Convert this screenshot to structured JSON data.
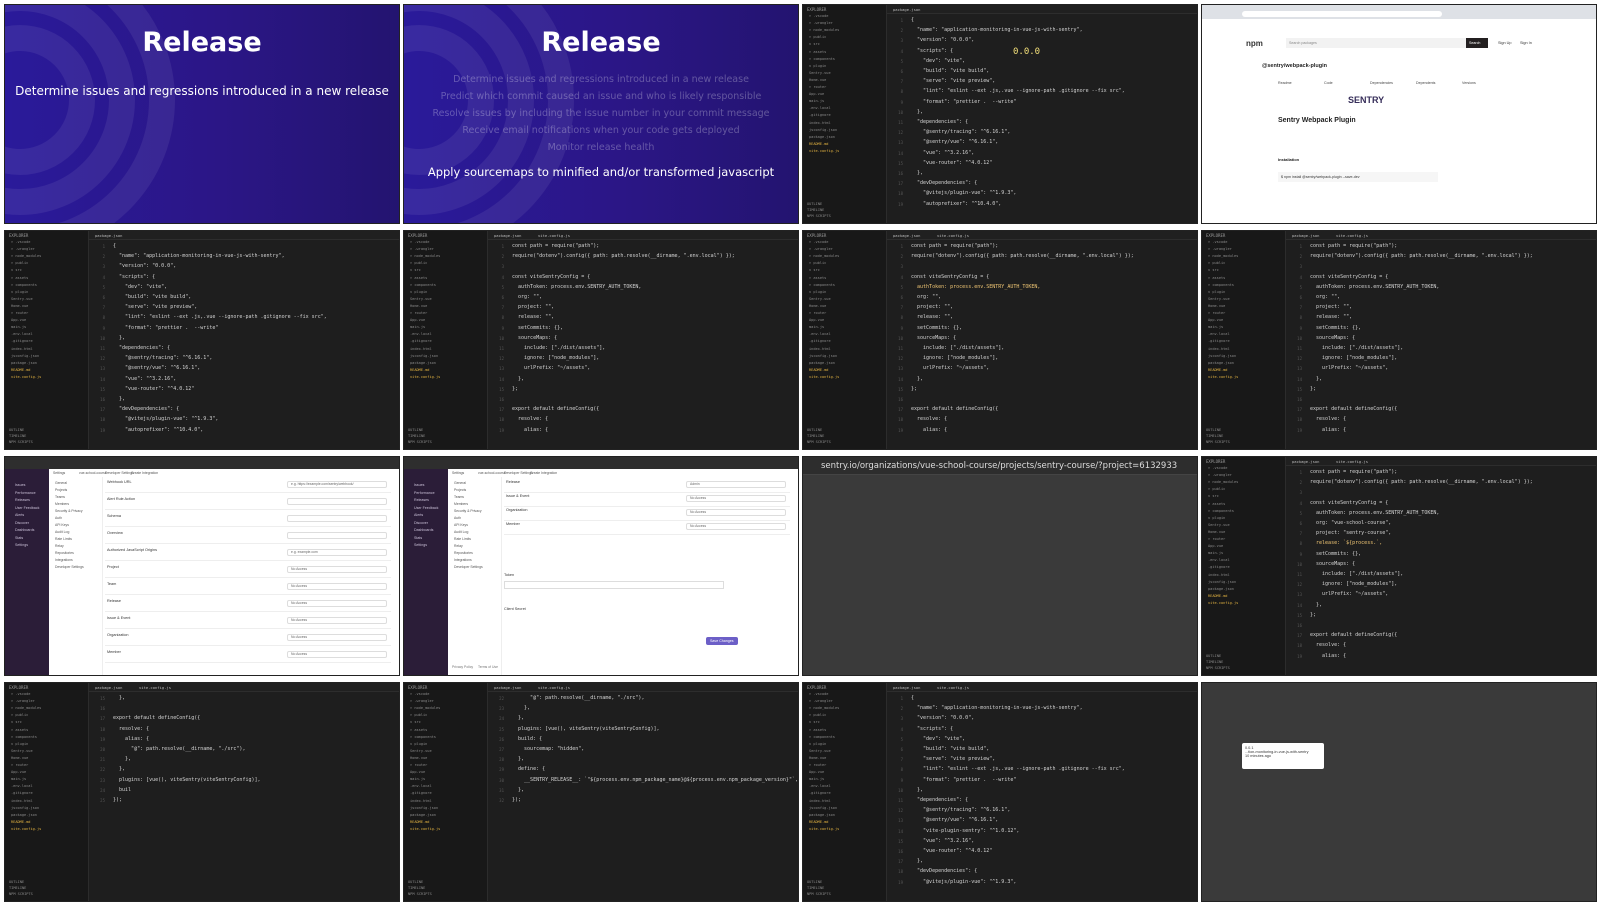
{
  "slides": {
    "release_title": "Release",
    "release_subtitle": "Determine issues and regressions introduced in a new release",
    "list_items": [
      "Determine issues and regressions introduced in a new release",
      "Predict which commit caused an issue and who is likely responsible",
      "Resolve issues by including the issue number in your commit message",
      "Receive email notifications when your code gets deployed",
      "Monitor release health"
    ],
    "highlight": "Apply sourcemaps to minified and/or transformed javascript"
  },
  "explorer": {
    "title": "EXPLORER",
    "items": [
      "> .vscode",
      "> .wrangler",
      "> node_modules",
      "> public",
      "v src",
      "> assets",
      "> components",
      "v plugin",
      "  Sentry.vue",
      "  Home.vue",
      "> router",
      "  App.vue",
      "  main.js",
      "  .env.local",
      "  .gitignore",
      "  index.html",
      "  jsconfig.json",
      "  package.json",
      "  README.md",
      "  vite.config.js"
    ],
    "outline": "OUTLINE",
    "timeline": "TIMELINE",
    "npm_scripts": "NPM SCRIPTS"
  },
  "tabs": {
    "package": "package.json",
    "vite": "vite.config.js"
  },
  "package_code": [
    "{",
    "  \"name\": \"application-monitoring-in-vue-js-with-sentry\",",
    "  \"version\": \"0.0.0\",",
    "  \"scripts\": {",
    "    \"dev\": \"vite\",",
    "    \"build\": \"vite build\",",
    "    \"serve\": \"vite preview\",",
    "    \"lint\": \"eslint --ext .js,.vue --ignore-path .gitignore --fix src\",",
    "    \"format\": \"prettier .  --write\"",
    "  },",
    "  \"dependencies\": {",
    "    \"@sentry/tracing\": \"^6.16.1\",",
    "    \"@sentry/vue\": \"^6.16.1\",",
    "    \"vue\": \"^3.2.16\",",
    "    \"vue-router\": \"^4.0.12\"",
    "  },",
    "  \"devDependencies\": {",
    "    \"@vitejs/plugin-vue\": \"^1.9.3\",",
    "    \"autoprefixer\": \"^10.4.0\","
  ],
  "version_hint": "0.0.0",
  "vite_code": [
    "const path = require(\"path\");",
    "require(\"dotenv\").config({ path: path.resolve(__dirname, \".env.local\") });",
    "",
    "const viteSentryConfig = {",
    "  authToken: process.env.SENTRY_AUTH_TOKEN,",
    "  org: \"\",",
    "  project: \"\",",
    "  release: \"\",",
    "  setCommits: {},",
    "  sourceMaps: {",
    "    include: [\"./dist/assets\"],",
    "    ignore: [\"node_modules\"],",
    "    urlPrefix: \"~/assets\",",
    "  },",
    "};",
    "",
    "export default defineConfig({",
    "  resolve: {",
    "    alias: {"
  ],
  "vite_code_filled": [
    "const path = require(\"path\");",
    "require(\"dotenv\").config({ path: path.resolve(__dirname, \".env.local\") });",
    "",
    "const viteSentryConfig = {",
    "  authToken: process.env.SENTRY_AUTH_TOKEN,",
    "  org: \"vue-school-course\",",
    "  project: \"sentry-course\",",
    "  release: `${process.`,",
    "  setCommits: {},",
    "  sourceMaps: {",
    "    include: [\"./dist/assets\"],",
    "    ignore: [\"node_modules\"],",
    "    urlPrefix: \"~/assets\",",
    "  },",
    "};",
    "",
    "export default defineConfig({",
    "  resolve: {",
    "    alias: {"
  ],
  "vite_tail": [
    "  },",
    "",
    "export default defineConfig({",
    "  resolve: {",
    "    alias: {",
    "      \"@\": path.resolve(__dirname, \"./src\"),",
    "    },",
    "  },",
    "  plugins: [vue(), viteSentry(viteSentryConfig)],",
    "  buil",
    "});"
  ],
  "vite_define": [
    "      \"@\": path.resolve(__dirname, \"./src\"),",
    "    },",
    "  },",
    "  plugins: [vue(), viteSentry(viteSentryConfig)],",
    "  build: {",
    "    sourcemap: \"hidden\",",
    "  },",
    "  define: {",
    "    __SENTRY_RELEASE__: `\"${process.env.npm_package_name}@${process.env.npm_package_version}\"`,",
    "  },",
    "});"
  ],
  "package_code_2": [
    "{",
    "  \"name\": \"application-monitoring-in-vue-js-with-sentry\",",
    "  \"version\": \"0.0.0\",",
    "  \"scripts\": {",
    "    \"dev\": \"vite\",",
    "    \"build\": \"vite build\",",
    "    \"serve\": \"vite preview\",",
    "    \"lint\": \"eslint --ext .js,.vue --ignore-path .gitignore --fix src\",",
    "    \"format\": \"prettier .  --write\"",
    "  },",
    "  \"dependencies\": {",
    "    \"@sentry/tracing\": \"^6.16.1\",",
    "    \"@sentry/vue\": \"^6.16.1\",",
    "    \"vite-plugin-sentry\": \"^1.0.12\",",
    "    \"vue\": \"^3.2.16\",",
    "    \"vue-router\": \"^4.0.12\"",
    "  },",
    "  \"devDependencies\": {",
    "    \"@vitejs/plugin-vue\": \"^1.9.3\","
  ],
  "npm": {
    "logo": "npm",
    "search_placeholder": "Search packages",
    "search_button": "Search",
    "sign_up": "Sign Up",
    "sign_in": "Sign In",
    "package_name": "@sentry/webpack-plugin",
    "brand": "SENTRY",
    "heading": "Sentry Webpack Plugin",
    "install_label": "Installation",
    "install_cmd": "$ npm install @sentry/webpack-plugin --save-dev",
    "tabs": [
      "Readme",
      "Code",
      "Dependencies",
      "Dependents",
      "Versions"
    ]
  },
  "sentry_settings": {
    "sidebar": [
      "Issues",
      "Performance",
      "Releases",
      "User Feedback",
      "Alerts",
      "Discover",
      "Dashboards",
      "Stats",
      "Settings"
    ],
    "nav": [
      "General",
      "Projects",
      "Teams",
      "Members",
      "Security & Privacy",
      "Auth",
      "API Keys",
      "Audit Log",
      "Rate Limits",
      "Relay",
      "Repositories",
      "Integrations",
      "Developer Settings"
    ],
    "breadcrumb": [
      "Settings",
      "vue-school-course",
      "Developer Settings",
      "Create Integration"
    ],
    "rows": [
      {
        "label": "Webhook URL",
        "value": "e.g. https://example.com/sentry/webhook/"
      },
      {
        "label": "Alert Rule Action",
        "value": ""
      },
      {
        "label": "Schema",
        "value": ""
      },
      {
        "label": "Overview",
        "value": ""
      },
      {
        "label": "Authorized JavaScript Origins",
        "value": "e.g. example.com"
      },
      {
        "label": "Project",
        "value": "No Access"
      },
      {
        "label": "Team",
        "value": "No Access"
      },
      {
        "label": "Release",
        "value": "No Access"
      },
      {
        "label": "Issue & Event",
        "value": "No Access"
      },
      {
        "label": "Organization",
        "value": "No Access"
      },
      {
        "label": "Member",
        "value": "No Access"
      }
    ],
    "rows2": [
      {
        "label": "Release",
        "value": "Admin"
      },
      {
        "label": "Issue & Event",
        "value": "No Access"
      },
      {
        "label": "Organization",
        "value": "No Access"
      },
      {
        "label": "Member",
        "value": "No Access"
      }
    ],
    "token_label": "Token",
    "client_secret_label": "Client Secret",
    "save_button": "Save Changes",
    "footer": [
      "Privacy Policy",
      "Terms of Use"
    ]
  },
  "dim": {
    "url": "sentry.io/organizations/vue-school-course/projects/sentry-course/?project=6132933"
  },
  "toast": {
    "title": "0.0.1",
    "line1": "...tion-monitoring-in-vue-js-with-sentry",
    "line2": "10 minutes ago"
  }
}
